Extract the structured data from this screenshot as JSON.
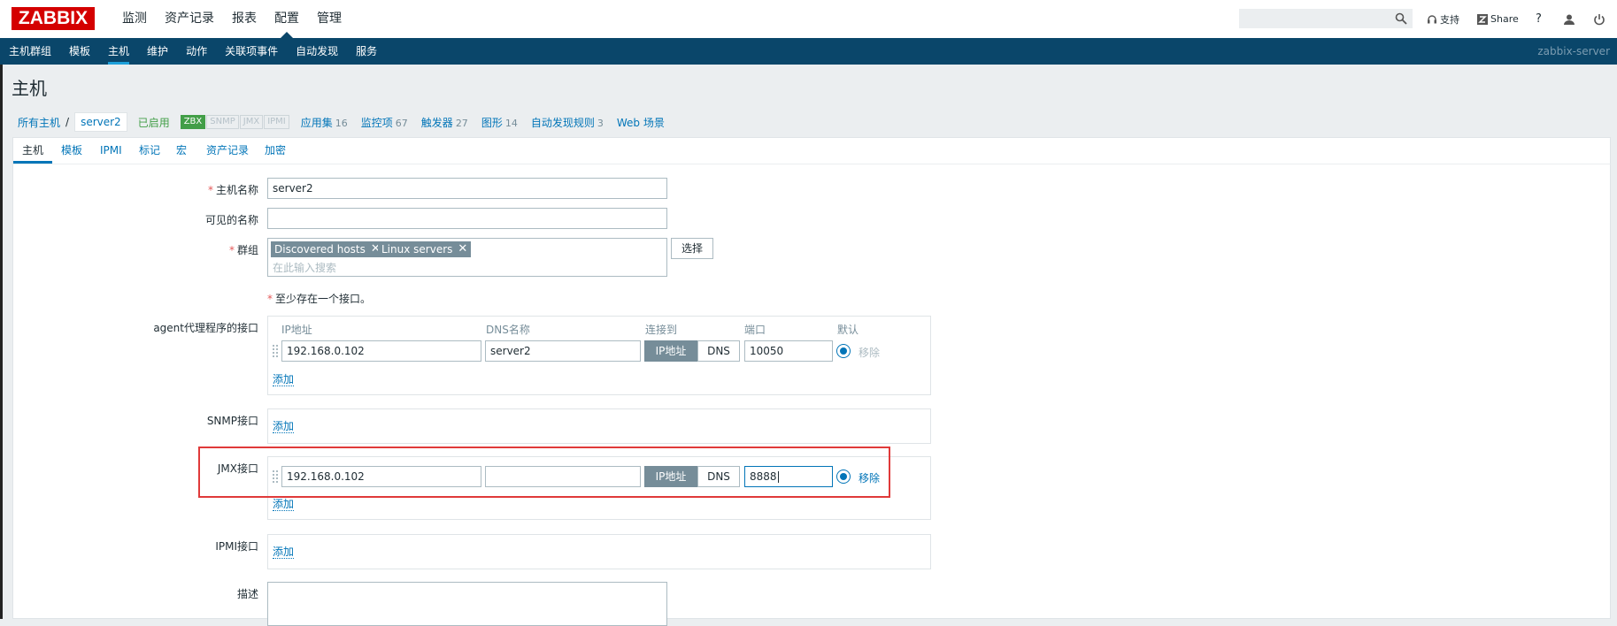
{
  "header": {
    "logo": "ZABBIX",
    "menu": [
      {
        "label": "监测"
      },
      {
        "label": "资产记录"
      },
      {
        "label": "报表"
      },
      {
        "label": "配置"
      },
      {
        "label": "管理"
      }
    ],
    "support": "支持",
    "share": "Share",
    "help": "?"
  },
  "submenu": {
    "items": [
      {
        "label": "主机群组"
      },
      {
        "label": "模板"
      },
      {
        "label": "主机"
      },
      {
        "label": "维护"
      },
      {
        "label": "动作"
      },
      {
        "label": "关联项事件"
      },
      {
        "label": "自动发现"
      },
      {
        "label": "服务"
      }
    ],
    "server": "zabbix-server"
  },
  "page": {
    "title": "主机"
  },
  "breadcrumb": {
    "all_hosts": "所有主机",
    "separator": "/",
    "host": "server2",
    "status": "已启用",
    "availability": [
      "ZBX",
      "SNMP",
      "JMX",
      "IPMI"
    ],
    "links": [
      {
        "label": "应用集",
        "count": "16"
      },
      {
        "label": "监控项",
        "count": "67"
      },
      {
        "label": "触发器",
        "count": "27"
      },
      {
        "label": "图形",
        "count": "14"
      },
      {
        "label": "自动发现规则",
        "count": "3"
      },
      {
        "label": "Web 场景",
        "count": ""
      }
    ]
  },
  "tabs": [
    {
      "label": "主机"
    },
    {
      "label": "模板"
    },
    {
      "label": "IPMI"
    },
    {
      "label": "标记"
    },
    {
      "label": "宏"
    },
    {
      "label": "资产记录"
    },
    {
      "label": "加密"
    }
  ],
  "form": {
    "host_name_label": "主机名称",
    "host_name_value": "server2",
    "visible_name_label": "可见的名称",
    "visible_name_value": "",
    "groups_label": "群组",
    "groups": [
      "Discovered hosts",
      "Linux servers"
    ],
    "groups_placeholder": "在此输入搜索",
    "select_button": "选择",
    "interface_note": "至少存在一个接口。",
    "agent_label": "agent代理程序的接口",
    "columns": {
      "ip": "IP地址",
      "dns": "DNS名称",
      "connect": "连接到",
      "port": "端口",
      "default": "默认"
    },
    "agent_interface": {
      "ip": "192.168.0.102",
      "dns": "server2",
      "connect_ip": "IP地址",
      "connect_dns": "DNS",
      "port": "10050",
      "remove": "移除"
    },
    "add_label": "添加",
    "snmp_label": "SNMP接口",
    "jmx_label": "JMX接口",
    "jmx_interface": {
      "ip": "192.168.0.102",
      "dns": "",
      "connect_ip": "IP地址",
      "connect_dns": "DNS",
      "port": "8888",
      "remove": "移除"
    },
    "ipmi_label": "IPMI接口",
    "description_label": "描述"
  }
}
